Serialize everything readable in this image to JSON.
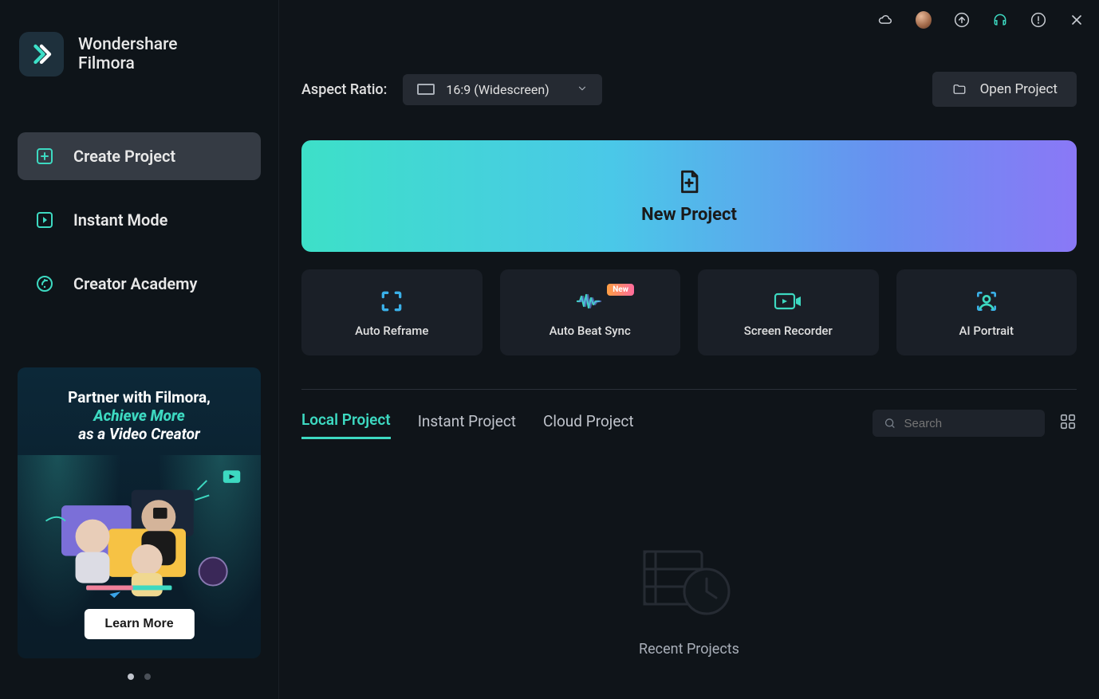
{
  "brand": {
    "line1": "Wondershare",
    "line2": "Filmora"
  },
  "nav": {
    "create_project": "Create Project",
    "instant_mode": "Instant Mode",
    "creator_academy": "Creator Academy"
  },
  "promo": {
    "line1": "Partner with Filmora,",
    "line2": "Achieve More",
    "line3": "as a Video Creator",
    "button": "Learn More"
  },
  "topbar": {
    "aspect_label": "Aspect Ratio:",
    "aspect_value": "16:9 (Widescreen)",
    "open_project": "Open Project"
  },
  "new_project": "New Project",
  "features": {
    "auto_reframe": "Auto Reframe",
    "auto_beat_sync": "Auto Beat Sync",
    "beat_badge": "New",
    "screen_recorder": "Screen Recorder",
    "ai_portrait": "AI Portrait"
  },
  "tabs": {
    "local": "Local Project",
    "instant": "Instant Project",
    "cloud": "Cloud Project"
  },
  "search": {
    "placeholder": "Search"
  },
  "empty": {
    "label": "Recent Projects"
  }
}
